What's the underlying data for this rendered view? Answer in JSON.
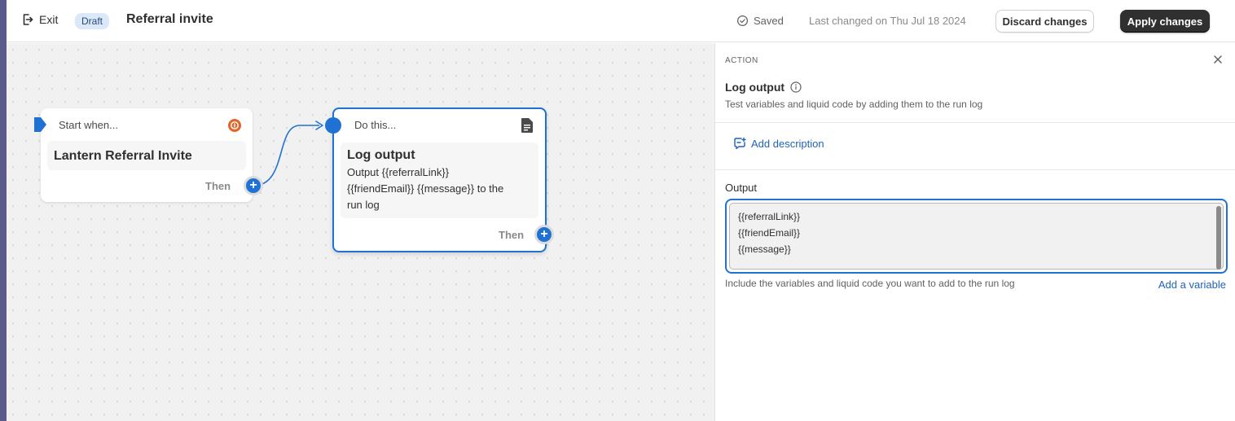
{
  "header": {
    "exit_label": "Exit",
    "status_badge": "Draft",
    "title": "Referral invite",
    "saved_label": "Saved",
    "last_changed": "Last changed on Thu Jul 18 2024",
    "discard_label": "Discard changes",
    "apply_label": "Apply changes"
  },
  "canvas": {
    "trigger_node": {
      "header": "Start when...",
      "title": "Lantern Referral Invite",
      "then_label": "Then"
    },
    "action_node": {
      "header": "Do this...",
      "title": "Log output",
      "description_lines": [
        "Output {{referralLink}}",
        "{{friendEmail}} {{message}} to the",
        "run log"
      ],
      "then_label": "Then"
    }
  },
  "panel": {
    "section_label": "ACTION",
    "title": "Log output",
    "subtitle": "Test variables and liquid code by adding them to the run log",
    "add_description_label": "Add description",
    "output_label": "Output",
    "output_lines": [
      "{{referralLink}}",
      "{{friendEmail}}",
      "{{message}}"
    ],
    "help_text": "Include the variables and liquid code you want to add to the run log",
    "add_variable_label": "Add a variable"
  },
  "colors": {
    "accent": "#1f72d4",
    "link": "#1f63b8",
    "primary_button": "#303030",
    "trigger_icon": "#e0672a"
  },
  "icons": {
    "exit": "exit-icon",
    "saved": "check-circle-icon",
    "trigger": "trigger-flag-icon",
    "app_badge": "app-badge-icon",
    "document": "document-icon",
    "info": "info-icon",
    "close": "close-icon",
    "description": "comment-add-icon",
    "add": "plus-icon"
  }
}
